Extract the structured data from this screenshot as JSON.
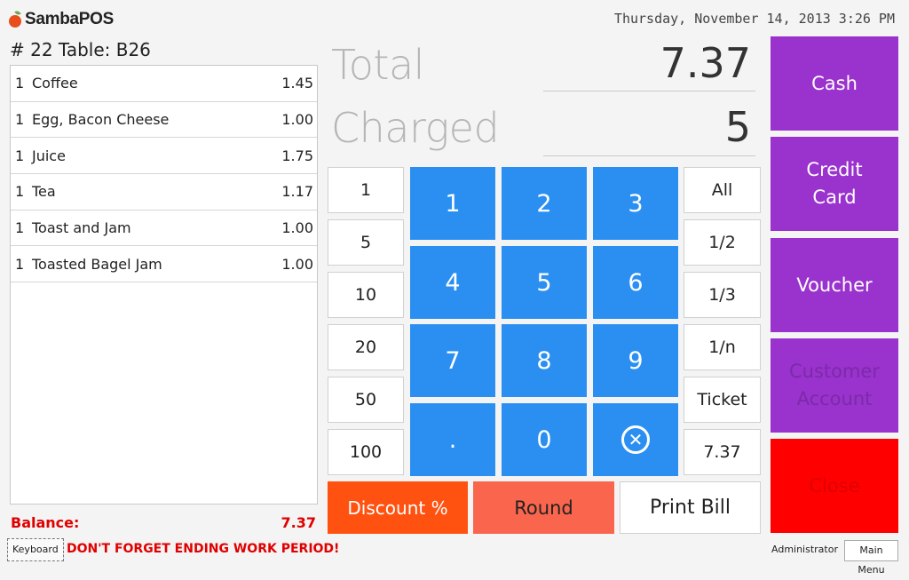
{
  "app": {
    "name": "SambaPOS"
  },
  "header": {
    "datetime": "Thursday, November 14, 2013 3:26 PM"
  },
  "ticket": {
    "title": "# 22 Table: B26",
    "orders": [
      {
        "qty": "1",
        "name": "Coffee",
        "price": "1.45"
      },
      {
        "qty": "1",
        "name": "Egg, Bacon Cheese",
        "price": "1.00"
      },
      {
        "qty": "1",
        "name": "Juice",
        "price": "1.75"
      },
      {
        "qty": "1",
        "name": "Tea",
        "price": "1.17"
      },
      {
        "qty": "1",
        "name": "Toast and Jam",
        "price": "1.00"
      },
      {
        "qty": "1",
        "name": "Toasted Bagel Jam",
        "price": "1.00"
      }
    ],
    "balance_label": "Balance:",
    "balance_value": "7.37"
  },
  "payment": {
    "total_label": "Total",
    "total_value": "7.37",
    "charged_label": "Charged",
    "charged_value": "5"
  },
  "keypad": {
    "amounts": [
      "1",
      "5",
      "10",
      "20",
      "50",
      "100"
    ],
    "digits": [
      "1",
      "2",
      "3",
      "4",
      "5",
      "6",
      "7",
      "8",
      "9",
      ".",
      "0"
    ],
    "clear_glyph": "✕",
    "splits": [
      "All",
      "1/2",
      "1/3",
      "1/n",
      "Ticket",
      "7.37"
    ]
  },
  "actions": {
    "discount": "Discount %",
    "round": "Round",
    "print_bill": "Print Bill"
  },
  "payment_methods": {
    "cash": "Cash",
    "credit_card_line1": "Credit",
    "credit_card_line2": "Card",
    "voucher": "Voucher",
    "customer_account_line1": "Customer",
    "customer_account_line2": "Account",
    "close": "Close"
  },
  "footer": {
    "keyboard": "Keyboard",
    "warning": "DON'T FORGET ENDING WORK PERIOD!",
    "user": "Administrator",
    "main_menu": "Main Menu"
  },
  "colors": {
    "keypad_blue": "#2b8ff2",
    "payment_purple": "#9a32cd",
    "close_red": "#ff0000",
    "discount_orange": "#ff5210",
    "round_salmon": "#fa654d",
    "warning_red": "#e00000"
  }
}
